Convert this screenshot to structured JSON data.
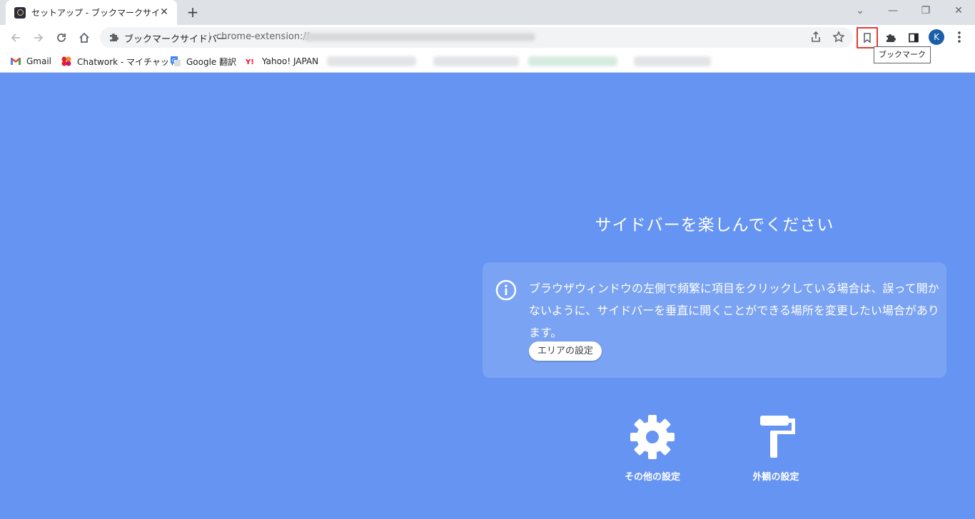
{
  "window": {
    "tab_title": "セットアップ - ブックマークサイドバー",
    "tab_close_icon": "close-icon",
    "new_tab_symbol": "+",
    "minimize_icon": "minimize-icon",
    "restore_icon": "restore-icon",
    "close_icon": "close-icon"
  },
  "toolbar": {
    "site_name": "ブックマークサイドバー",
    "url": "chrome-extension://",
    "avatar_letter": "K",
    "tooltip": "ブックマーク"
  },
  "bookmarks": [
    {
      "label": "Gmail",
      "icon": "gmail-icon"
    },
    {
      "label": "Chatwork - マイチャット",
      "icon": "chatwork-icon"
    },
    {
      "label": "Google 翻訳",
      "icon": "google-translate-icon"
    },
    {
      "label": "Yahoo! JAPAN",
      "icon": "yahoo-icon"
    }
  ],
  "content": {
    "headline": "サイドバーを楽しんでください",
    "info_text": "ブラウザウィンドウの左側で頻繁に項目をクリックしている場合は、誤って開かないように、サイドバーを垂直に開くことができる場所を変更したい場合があります。",
    "area_button": "エリアの設定",
    "other_settings": "その他の設定",
    "appearance_settings": "外観の設定"
  },
  "colors": {
    "background": "#6694f2",
    "bookmark_highlight": "#e03c31",
    "avatar": "#1a5fa8"
  }
}
